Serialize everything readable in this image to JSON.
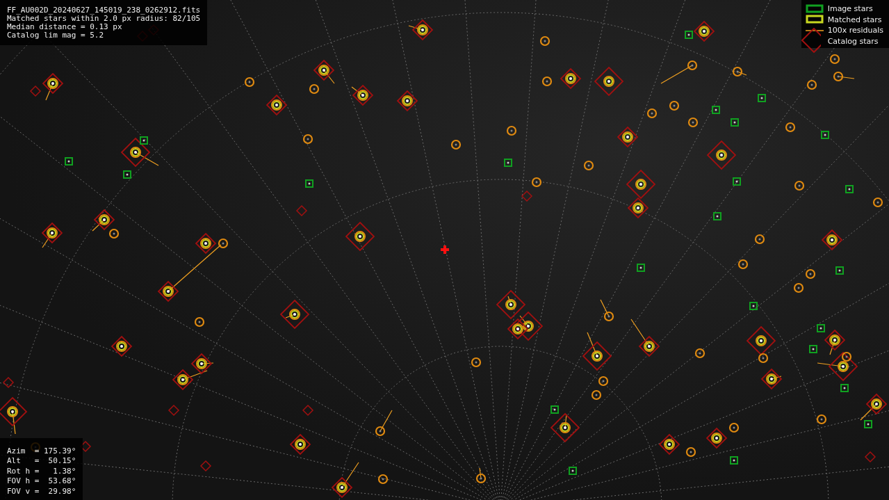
{
  "info_lines": [
    "FF_AU002D_20240627_145019_238_0262912.fits",
    "Matched stars within 2.0 px radius: 82/105",
    "Median distance = 0.13 px",
    "Catalog lim mag = 5.2"
  ],
  "legend": [
    {
      "kind": "image",
      "label": "Image stars"
    },
    {
      "kind": "matched",
      "label": "Matched stars"
    },
    {
      "kind": "residuals",
      "label": "100x residuals"
    },
    {
      "kind": "catalog",
      "label": "Catalog stars"
    }
  ],
  "camera_params": [
    "Azim  = 175.39°",
    "Alt   =  50.15°",
    "Rot h =   1.38°",
    "FOV h =  53.68°",
    "FOV v =  29.98°"
  ]
}
